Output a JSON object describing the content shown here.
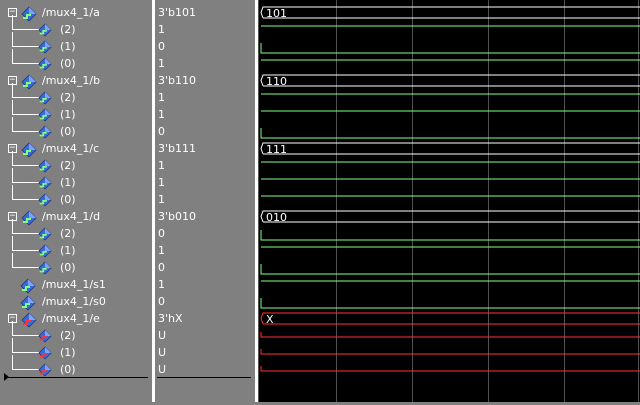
{
  "signals": [
    {
      "name": "/mux4_1/a",
      "value": "3'b101",
      "bus": "101",
      "color": "green",
      "expanded": true,
      "bits": [
        {
          "name": "(2)",
          "value": "1"
        },
        {
          "name": "(1)",
          "value": "0"
        },
        {
          "name": "(0)",
          "value": "1"
        }
      ]
    },
    {
      "name": "/mux4_1/b",
      "value": "3'b110",
      "bus": "110",
      "color": "green",
      "expanded": true,
      "bits": [
        {
          "name": "(2)",
          "value": "1"
        },
        {
          "name": "(1)",
          "value": "1"
        },
        {
          "name": "(0)",
          "value": "0"
        }
      ]
    },
    {
      "name": "/mux4_1/c",
      "value": "3'b111",
      "bus": "111",
      "color": "green",
      "expanded": true,
      "bits": [
        {
          "name": "(2)",
          "value": "1"
        },
        {
          "name": "(1)",
          "value": "1"
        },
        {
          "name": "(0)",
          "value": "1"
        }
      ]
    },
    {
      "name": "/mux4_1/d",
      "value": "3'b010",
      "bus": "010",
      "color": "green",
      "expanded": true,
      "bits": [
        {
          "name": "(2)",
          "value": "0"
        },
        {
          "name": "(1)",
          "value": "1"
        },
        {
          "name": "(0)",
          "value": "0"
        }
      ]
    },
    {
      "name": "/mux4_1/s1",
      "value": "1",
      "color": "green",
      "expanded": false,
      "bits": []
    },
    {
      "name": "/mux4_1/s0",
      "value": "0",
      "color": "green",
      "expanded": false,
      "bits": []
    },
    {
      "name": "/mux4_1/e",
      "value": "3'hX",
      "bus": "X",
      "color": "red",
      "expanded": true,
      "bits": [
        {
          "name": "(2)",
          "value": "U"
        },
        {
          "name": "(1)",
          "value": "U"
        },
        {
          "name": "(0)",
          "value": "U"
        }
      ]
    }
  ],
  "colors": {
    "green": "#7fff7f",
    "red": "#ff3333",
    "bus_white": "#ffffff"
  }
}
